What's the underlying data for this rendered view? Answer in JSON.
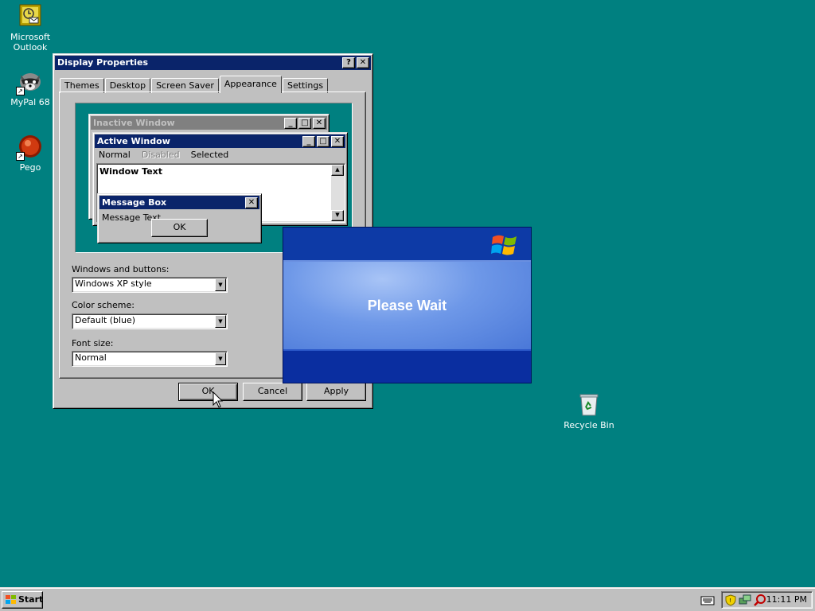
{
  "desktop": {
    "icons": [
      {
        "label": "Microsoft Outlook",
        "icon": "outlook-icon"
      },
      {
        "label": "MyPal 68",
        "icon": "raccoon-browser-icon"
      },
      {
        "label": "Pego",
        "icon": "red-ball-icon"
      },
      {
        "label": "Recycle Bin",
        "icon": "recycle-bin-icon"
      }
    ]
  },
  "dialog": {
    "title": "Display Properties",
    "help_glyph": "?",
    "close_glyph": "✕",
    "tabs": [
      "Themes",
      "Desktop",
      "Screen Saver",
      "Appearance",
      "Settings"
    ],
    "active_tab": "Appearance",
    "preview": {
      "inactive_title": "Inactive Window",
      "active_title": "Active Window",
      "menu_normal": "Normal",
      "menu_disabled": "Disabled",
      "menu_selected": "Selected",
      "window_text": "Window Text",
      "msgbox_title": "Message Box",
      "msgbox_text": "Message Text",
      "msgbox_ok": "OK"
    },
    "windows_buttons_label": "Windows and buttons:",
    "windows_buttons_value": "Windows XP style",
    "color_scheme_label": "Color scheme:",
    "color_scheme_value": "Default (blue)",
    "font_size_label": "Font size:",
    "font_size_value": "Normal",
    "ok": "OK",
    "cancel": "Cancel",
    "apply": "Apply"
  },
  "please_wait": {
    "text": "Please Wait",
    "logo": "windows-xp-logo"
  },
  "taskbar": {
    "start": "Start",
    "clock": "11:11 PM"
  },
  "colors": {
    "desktop": "#008080",
    "titlebar_active": "#0a246a",
    "titlebar_inactive": "#808080",
    "xp_blue": "#0831a5"
  }
}
